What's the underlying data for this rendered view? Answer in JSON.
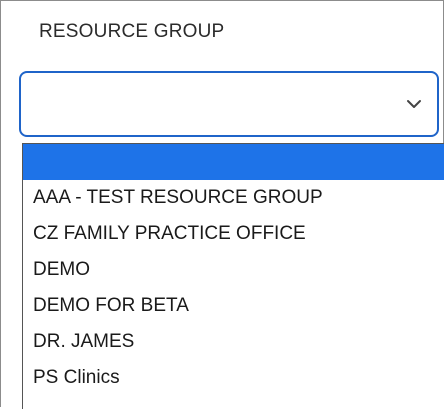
{
  "field": {
    "label": "RESOURCE GROUP",
    "selected_value": ""
  },
  "dropdown": {
    "options": [
      {
        "label": "",
        "selected": true
      },
      {
        "label": "AAA - TEST RESOURCE GROUP",
        "selected": false
      },
      {
        "label": "CZ FAMILY PRACTICE OFFICE",
        "selected": false
      },
      {
        "label": "DEMO",
        "selected": false
      },
      {
        "label": "DEMO FOR BETA",
        "selected": false
      },
      {
        "label": "DR. JAMES",
        "selected": false
      },
      {
        "label": "PS Clinics",
        "selected": false
      }
    ]
  },
  "colors": {
    "accent": "#1f64c9",
    "highlight": "#1e73e8"
  },
  "icons": {
    "dropdown_toggle": "chevron-down-icon"
  }
}
